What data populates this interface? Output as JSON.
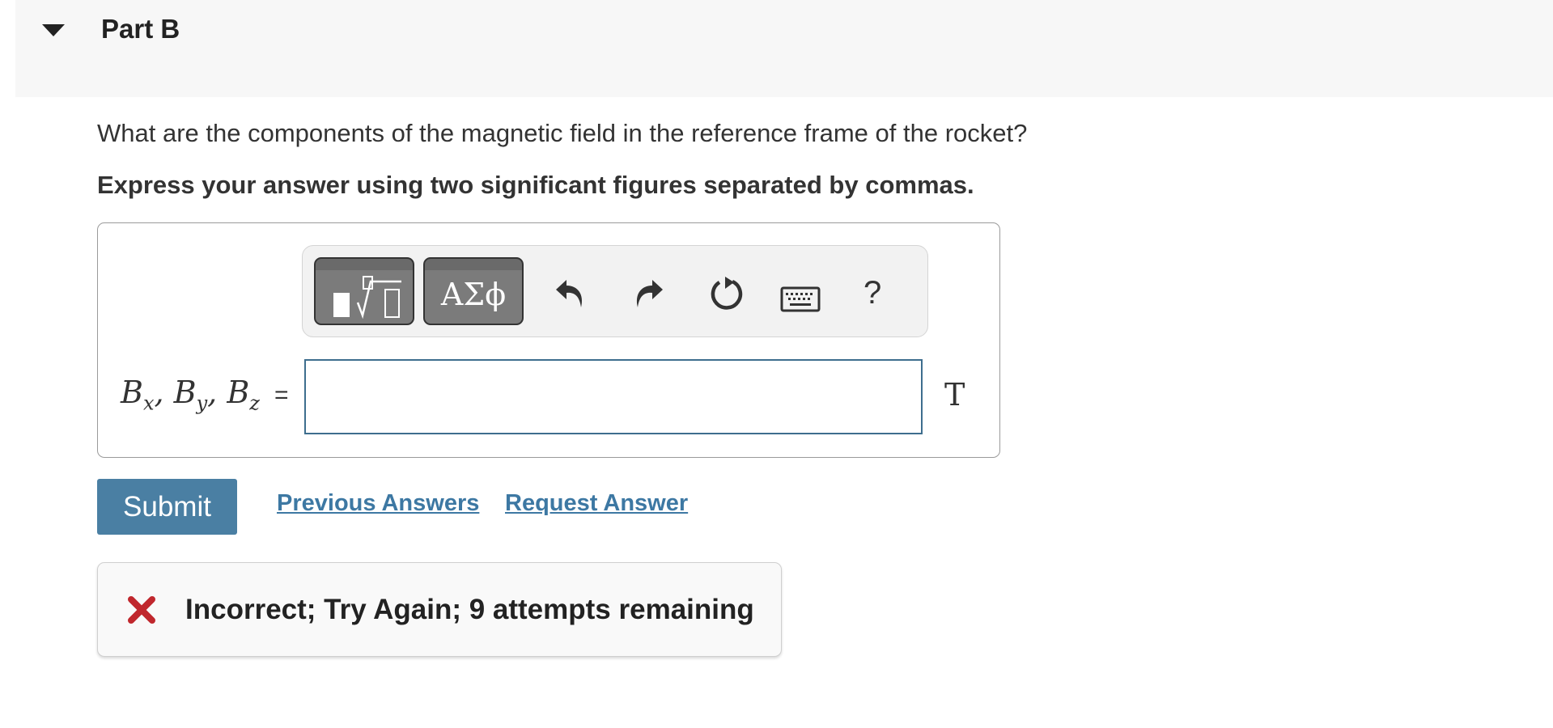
{
  "part": {
    "title": "Part B"
  },
  "question": {
    "text": "What are the components of the magnetic field in the reference frame of the rocket?",
    "instruction": "Express your answer using two significant figures separated by commas."
  },
  "toolbar": {
    "greek_label": "ΑΣϕ",
    "help_label": "?",
    "icons": [
      "templates-icon",
      "greek-letters-icon",
      "undo-icon",
      "redo-icon",
      "reset-icon",
      "keyboard-icon",
      "help-icon"
    ]
  },
  "answer": {
    "variables": [
      "B",
      "x",
      "B",
      "y",
      "B",
      "z"
    ],
    "equals": "=",
    "value": "",
    "unit": "T"
  },
  "actions": {
    "submit_label": "Submit",
    "previous_answers_label": "Previous Answers",
    "request_answer_label": "Request Answer"
  },
  "feedback": {
    "message": "Incorrect; Try Again; 9 attempts remaining",
    "status_color": "#c0272d"
  },
  "colors": {
    "accent": "#4a7fa3",
    "link": "#3d78a3",
    "input_border": "#3e6e8e"
  }
}
